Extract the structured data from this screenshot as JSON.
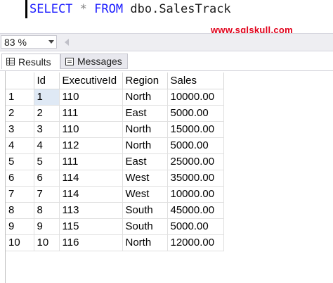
{
  "editor": {
    "query": {
      "select": "SELECT",
      "star": "*",
      "from": "FROM",
      "object": "dbo.SalesTrack"
    },
    "watermark": "www.sqlskull.com"
  },
  "zoom": {
    "value": "83 %"
  },
  "tabs": {
    "results": "Results",
    "messages": "Messages"
  },
  "results": {
    "columns": [
      "Id",
      "ExecutiveId",
      "Region",
      "Sales"
    ],
    "rows": [
      {
        "rownum": "1",
        "id": "1",
        "exec": "110",
        "region": "North",
        "sales": "10000.00"
      },
      {
        "rownum": "2",
        "id": "2",
        "exec": "111",
        "region": "East",
        "sales": "5000.00"
      },
      {
        "rownum": "3",
        "id": "3",
        "exec": "110",
        "region": "North",
        "sales": "15000.00"
      },
      {
        "rownum": "4",
        "id": "4",
        "exec": "112",
        "region": "North",
        "sales": "5000.00"
      },
      {
        "rownum": "5",
        "id": "5",
        "exec": "111",
        "region": "East",
        "sales": "25000.00"
      },
      {
        "rownum": "6",
        "id": "6",
        "exec": "114",
        "region": "West",
        "sales": "35000.00"
      },
      {
        "rownum": "7",
        "id": "7",
        "exec": "114",
        "region": "West",
        "sales": "10000.00"
      },
      {
        "rownum": "8",
        "id": "8",
        "exec": "113",
        "region": "South",
        "sales": "45000.00"
      },
      {
        "rownum": "9",
        "id": "9",
        "exec": "115",
        "region": "South",
        "sales": "5000.00"
      },
      {
        "rownum": "10",
        "id": "10",
        "exec": "116",
        "region": "North",
        "sales": "12000.00"
      }
    ]
  },
  "colors": {
    "keyword": "#1a1aff",
    "watermark": "#e0001a",
    "selected_cell": "#dfe9f5"
  }
}
